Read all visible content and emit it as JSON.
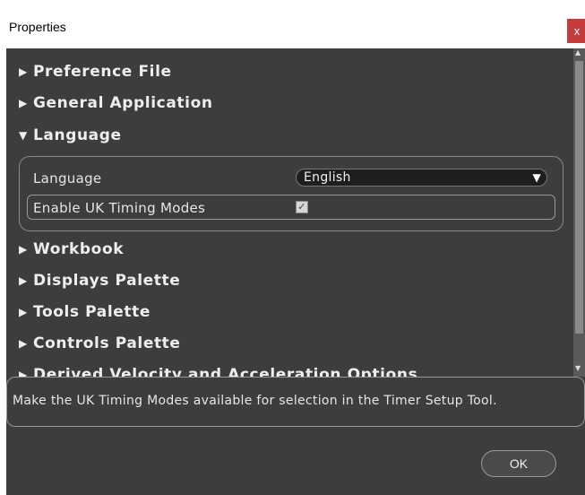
{
  "window": {
    "title": "Properties",
    "close_label": "x"
  },
  "sections": {
    "preference_file": "Preference File",
    "general_application": "General Application",
    "language": "Language",
    "workbook": "Workbook",
    "displays_palette": "Displays Palette",
    "tools_palette": "Tools Palette",
    "controls_palette": "Controls Palette",
    "derived_velocity": "Derived Velocity and Acceleration Options"
  },
  "language_settings": {
    "language_label": "Language",
    "language_value": "English",
    "uk_timing_label": "Enable UK Timing Modes",
    "uk_timing_checked": true
  },
  "description_text": "Make the UK Timing Modes available for selection in the Timer Setup Tool.",
  "buttons": {
    "ok_label": "OK"
  },
  "icons": {
    "collapsed": "▶",
    "expanded": "▼",
    "dropdown_arrow": "▼",
    "checkmark": "✓"
  },
  "colors": {
    "panel_bg": "#3d3d3d",
    "close_button": "#c63b3b"
  }
}
